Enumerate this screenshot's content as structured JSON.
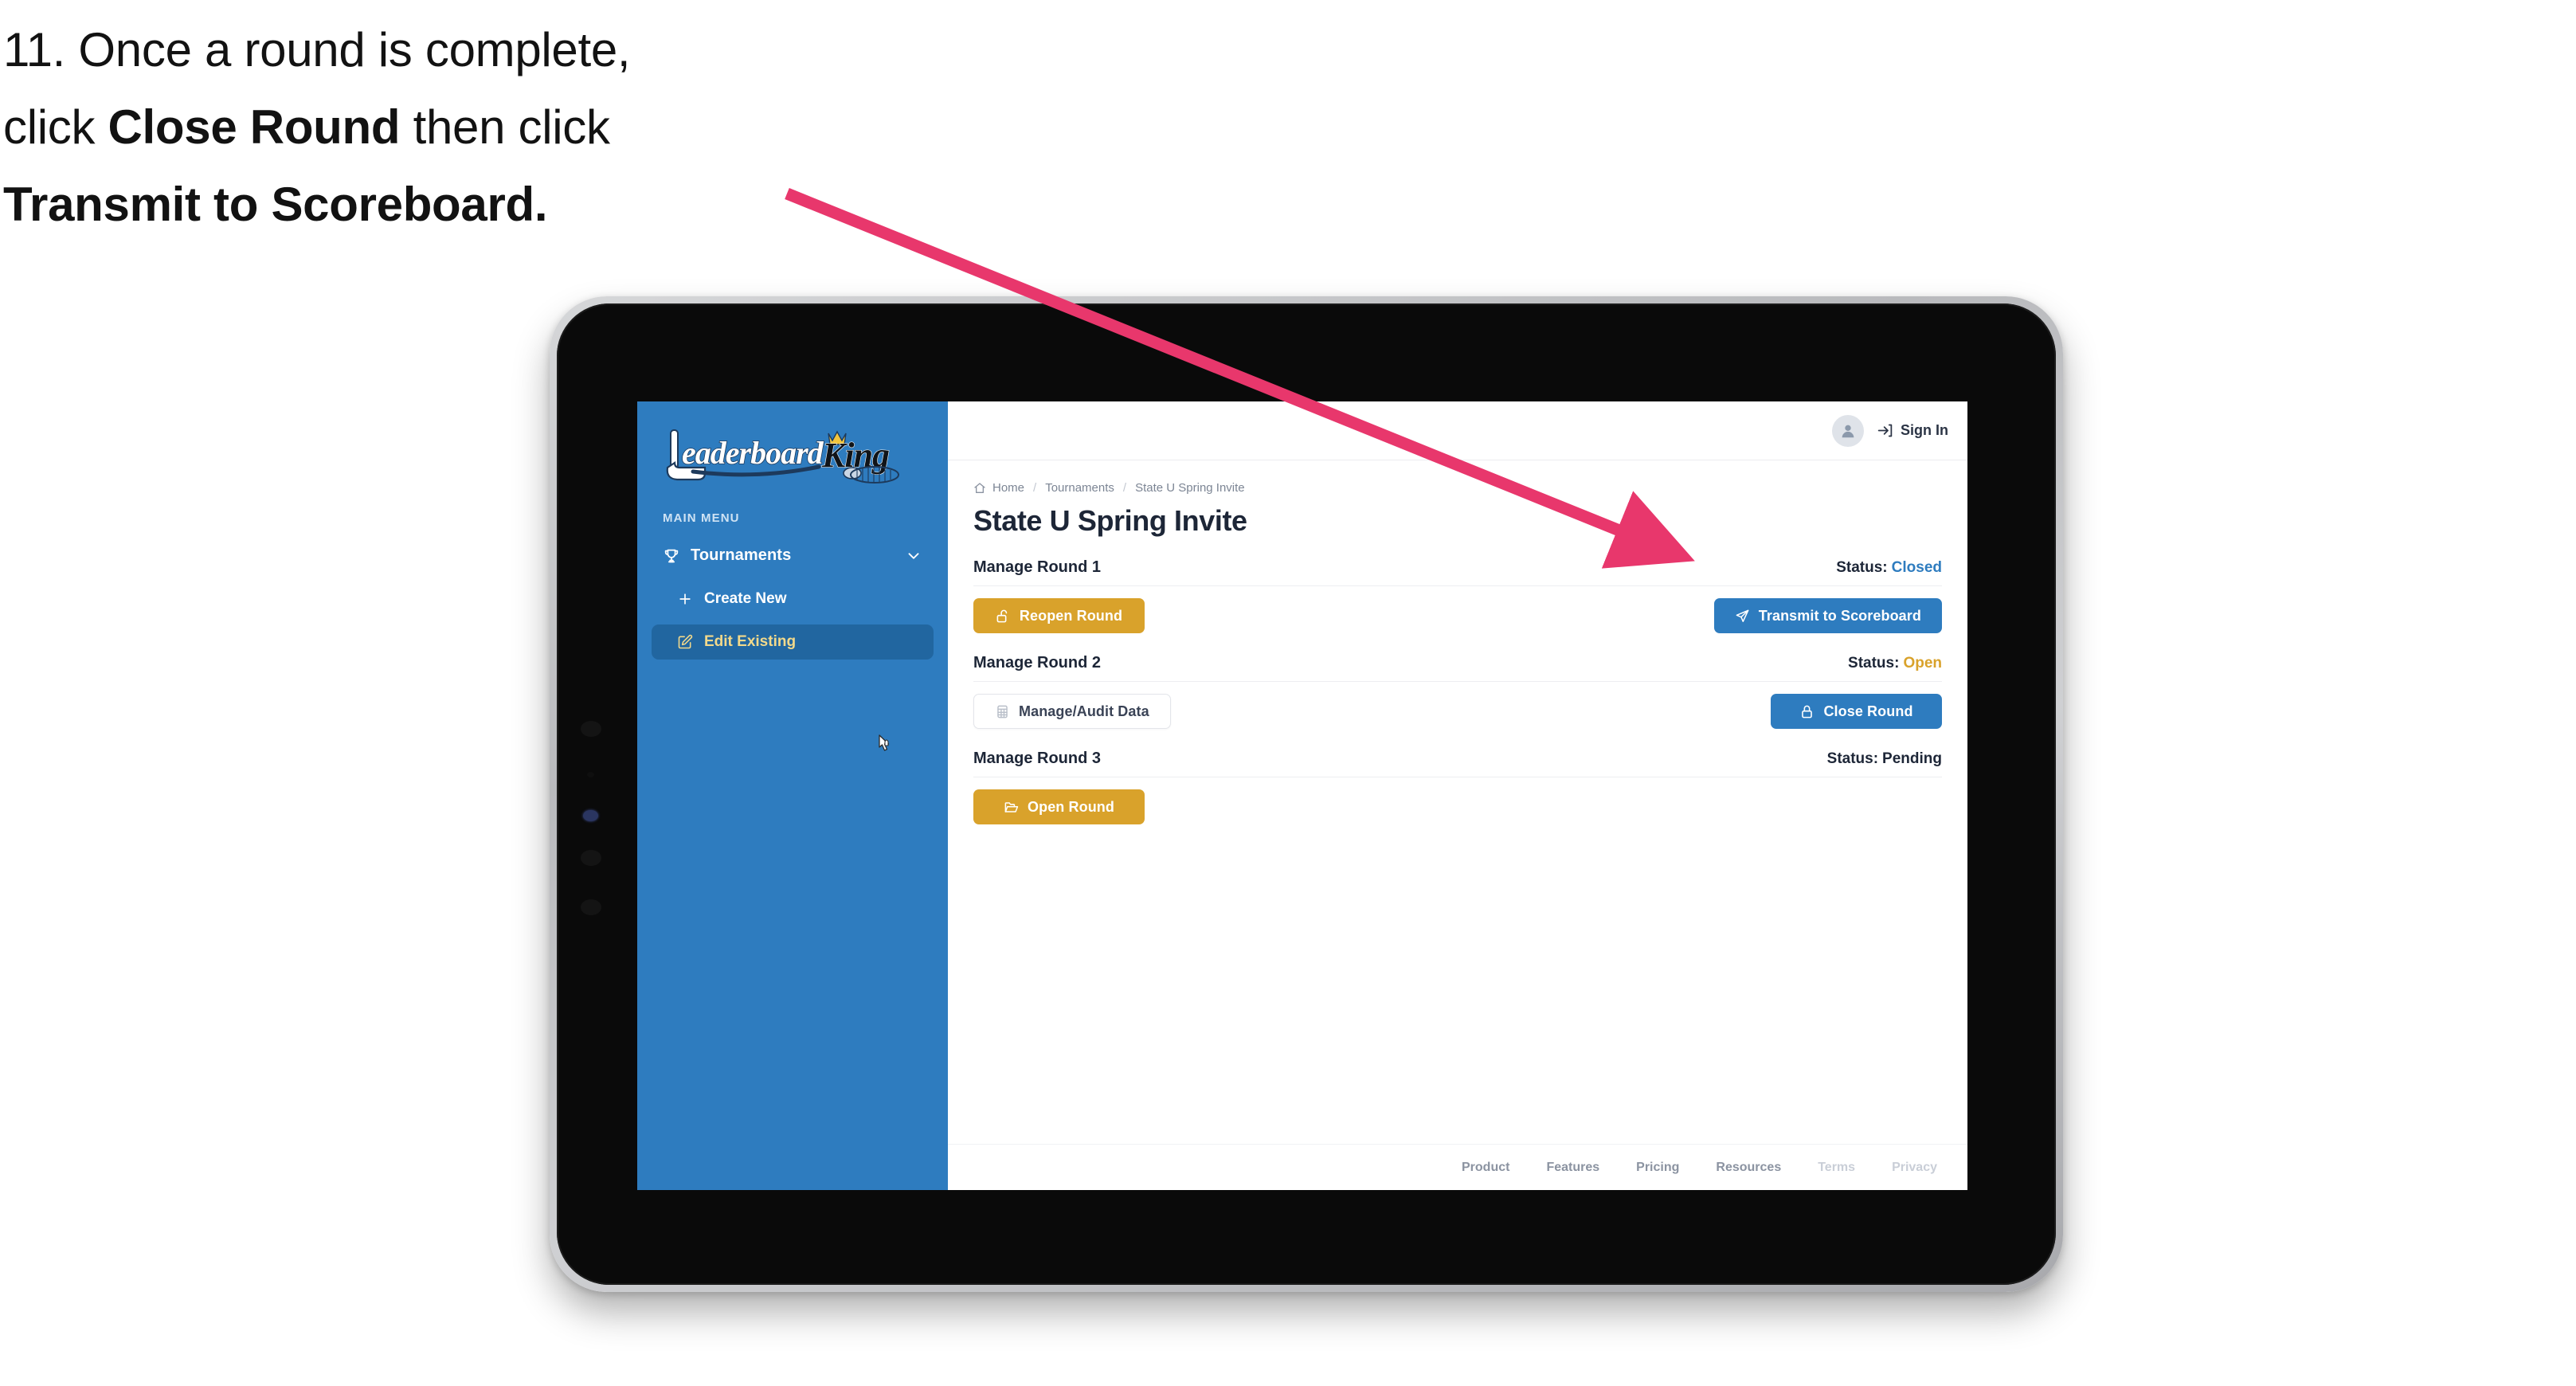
{
  "caption": {
    "line1": "11. Once a round is complete,",
    "line2_pre": "click ",
    "line2_bold": "Close Round",
    "line2_post": " then click",
    "line3_bold": "Transmit to Scoreboard."
  },
  "annotation": {
    "arrow_color": "#E8376C",
    "points_to": "Transmit to Scoreboard"
  },
  "app": {
    "sidebar": {
      "logo_text_primary": "Leaderboard",
      "logo_text_secondary": "King",
      "menu_label": "MAIN MENU",
      "items": [
        {
          "label": "Tournaments",
          "icon": "trophy-icon",
          "chevron": "chevron-down-icon",
          "active": false
        },
        {
          "label": "Create New",
          "icon": "plus-icon",
          "active": false
        },
        {
          "label": "Edit Existing",
          "icon": "edit-pencil-icon",
          "active": true
        }
      ],
      "background_color": "#2E7CBF",
      "active_background_color": "#2166A0",
      "active_text_color": "#F2D98B"
    },
    "topbar": {
      "avatar_icon": "user-avatar-icon",
      "signin_icon": "sign-in-arrow-icon",
      "signin_label": "Sign In"
    },
    "breadcrumb": {
      "home_icon": "home-icon",
      "items": [
        "Home",
        "Tournaments",
        "State U Spring Invite"
      ],
      "separator": "/"
    },
    "page_title": "State U Spring Invite",
    "rounds": [
      {
        "name": "Manage Round 1",
        "status_label": "Status:",
        "status_value": "Closed",
        "status_color": "#2E7CBF",
        "left_button": {
          "label": "Reopen Round",
          "icon": "unlock-icon",
          "style": "gold"
        },
        "right_button": {
          "label": "Transmit to Scoreboard",
          "icon": "send-paper-plane-icon",
          "style": "blue"
        }
      },
      {
        "name": "Manage Round 2",
        "status_label": "Status:",
        "status_value": "Open",
        "status_color": "#D9A22B",
        "left_button": {
          "label": "Manage/Audit Data",
          "icon": "grid-table-icon",
          "style": "ghost"
        },
        "right_button": {
          "label": "Close Round",
          "icon": "lock-icon",
          "style": "blue"
        }
      },
      {
        "name": "Manage Round 3",
        "status_label": "Status:",
        "status_value": "Pending",
        "status_color": "#1D2637",
        "left_button": {
          "label": "Open Round",
          "icon": "open-folder-icon",
          "style": "gold"
        },
        "right_button": null
      }
    ],
    "footer": {
      "links": [
        {
          "label": "Product",
          "dim": false
        },
        {
          "label": "Features",
          "dim": false
        },
        {
          "label": "Pricing",
          "dim": false
        },
        {
          "label": "Resources",
          "dim": false
        },
        {
          "label": "Terms",
          "dim": true
        },
        {
          "label": "Privacy",
          "dim": true
        }
      ]
    }
  }
}
